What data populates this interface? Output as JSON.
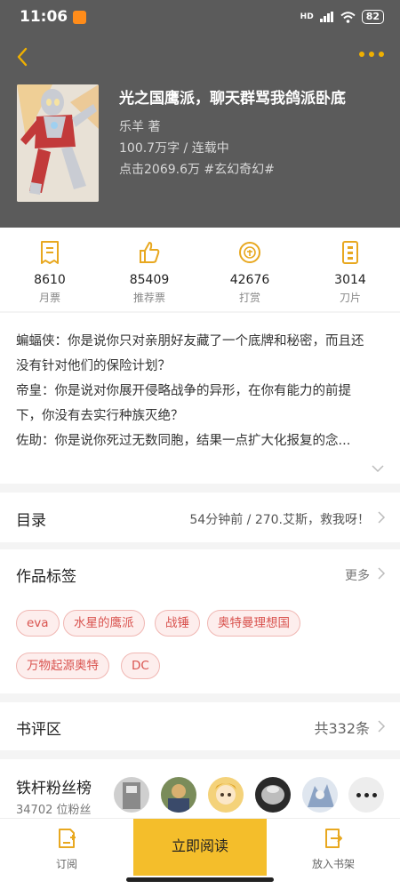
{
  "status_bar": {
    "time": "11:06",
    "network": "HD",
    "battery": "82"
  },
  "book": {
    "title": "光之国鹰派，聊天群骂我鸽派卧底",
    "author": "乐羊  著",
    "words_status": "100.7万字 / 连载中",
    "clicks_genre": "点击2069.6万  #玄幻奇幻#"
  },
  "stats": [
    {
      "value": "8610",
      "label": "月票",
      "icon": "ticket-icon"
    },
    {
      "value": "85409",
      "label": "推荐票",
      "icon": "thumbs-up-icon"
    },
    {
      "value": "42676",
      "label": "打赏",
      "icon": "reward-coin-icon"
    },
    {
      "value": "3014",
      "label": "刀片",
      "icon": "blade-card-icon"
    }
  ],
  "intro": [
    "蝙蝠侠：你是说你只对亲朋好友藏了一个底牌和秘密，而且还",
    "没有针对他们的保险计划？",
    "帝皇：你是说对你展开侵略战争的异形，在你有能力的前提",
    "下，你没有去实行种族灭绝？",
    "佐助：你是说你死过无数同胞，结果一点扩大化报复的念..."
  ],
  "catalog": {
    "title": "目录",
    "update": "54分钟前 / 270.艾斯，救我呀！"
  },
  "tags_section": {
    "title": "作品标签",
    "more": "更多",
    "tags": [
      "eva",
      "水星的鹰派",
      "战锤",
      "奥特曼理想国",
      "万物起源奥特",
      "DC"
    ]
  },
  "review": {
    "title": "书评区",
    "count": "共332条"
  },
  "fans": {
    "title": "铁杆粉丝榜",
    "count": "34702 位粉丝"
  },
  "bottom_bar": {
    "subscribe": "订阅",
    "read": "立即阅读",
    "shelf": "放入书架"
  },
  "colors": {
    "accent": "#f4be2b",
    "header_bg": "#5b5b5b",
    "tag_red": "#d9534f"
  }
}
